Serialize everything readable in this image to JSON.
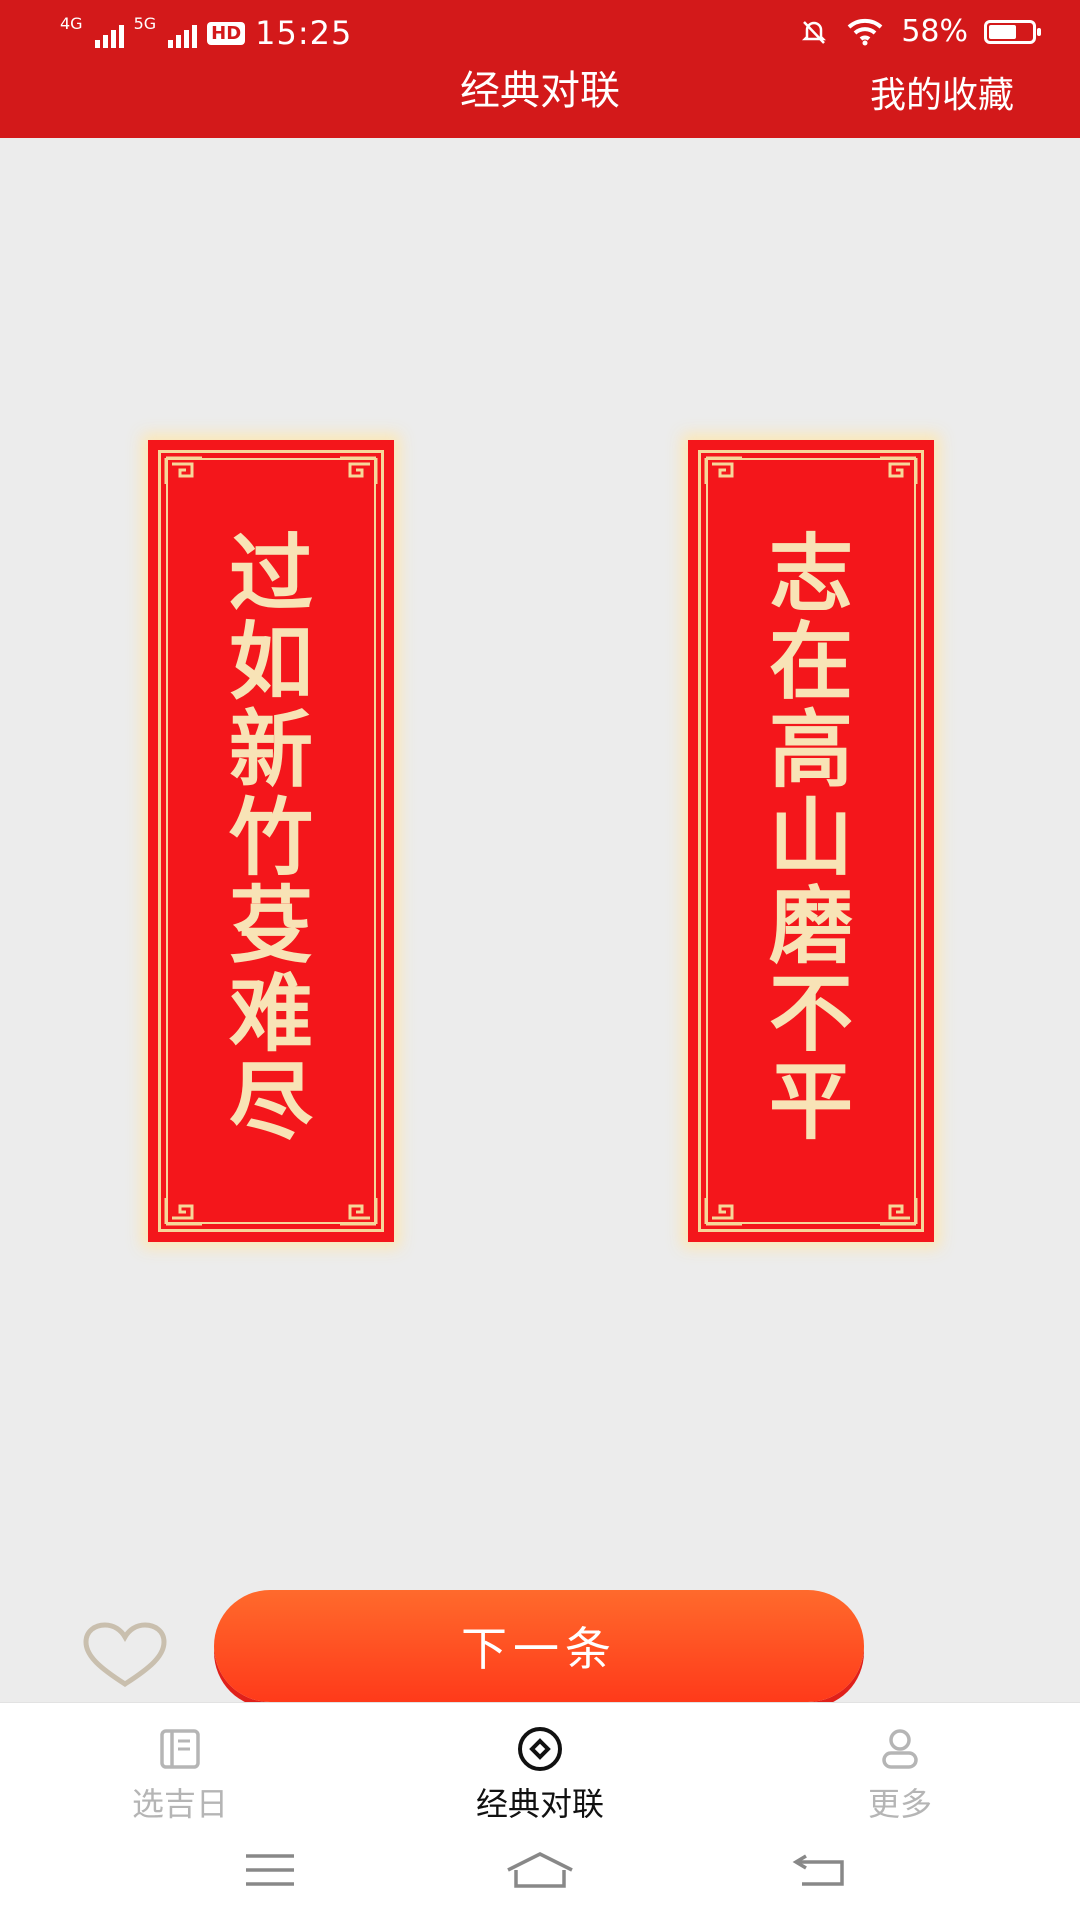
{
  "status_bar": {
    "net1": "4G",
    "net2": "5G",
    "hd": "HD",
    "time": "15:25",
    "battery": "58%",
    "battery_level": 0.58,
    "icons": [
      "signal-icon",
      "signal-icon",
      "hd-icon",
      "mute-icon",
      "wifi-icon",
      "battery-icon"
    ]
  },
  "header": {
    "title": "经典对联",
    "favorites_link": "我的收藏"
  },
  "couplets": {
    "left": [
      "过",
      "如",
      "新",
      "竹",
      "芟",
      "难",
      "尽"
    ],
    "right": [
      "志",
      "在",
      "高",
      "山",
      "磨",
      "不",
      "平"
    ]
  },
  "actions": {
    "favorite_icon": "heart-icon",
    "next_label": "下一条"
  },
  "tabbar": {
    "items": [
      {
        "label": "选吉日",
        "icon": "calendar-book-icon",
        "active": false
      },
      {
        "label": "经典对联",
        "icon": "coin-icon",
        "active": true
      },
      {
        "label": "更多",
        "icon": "user-icon",
        "active": false
      }
    ]
  },
  "colors": {
    "header_red": "#d3191a",
    "couplet_red": "#f4161b",
    "gold": "#f8e3b6",
    "button_orange": "#ff4e22"
  }
}
